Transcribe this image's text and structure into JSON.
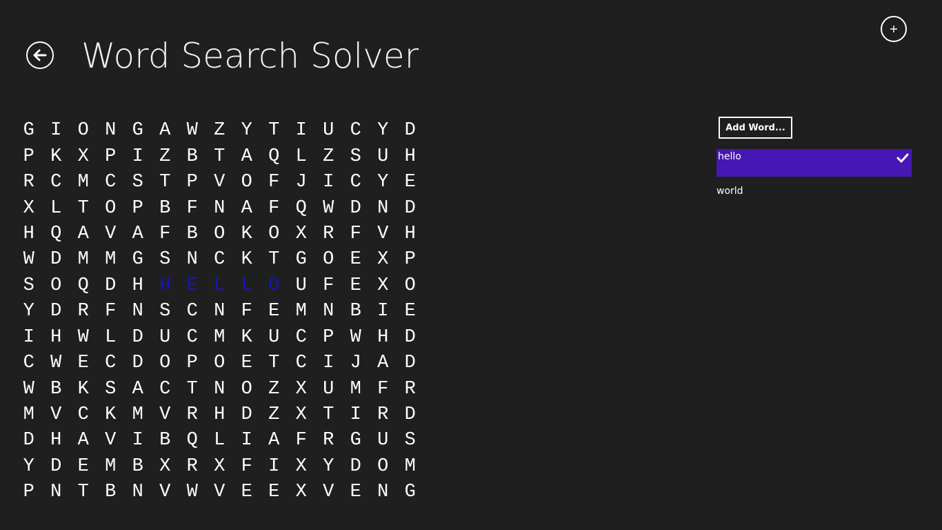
{
  "header": {
    "title": "Word Search Solver",
    "back_icon": "back-arrow-icon",
    "add_icon": "plus-icon"
  },
  "colors": {
    "background": "#1f1f1f",
    "accent": "#4617b4",
    "found_letter": "#1414c8",
    "text": "#ffffff"
  },
  "puzzle": {
    "rows": [
      [
        "G",
        "I",
        "O",
        "N",
        "G",
        "A",
        "W",
        "Z",
        "Y",
        "T",
        "I",
        "U",
        "C",
        "Y",
        "D"
      ],
      [
        "P",
        "K",
        "X",
        "P",
        "I",
        "Z",
        "B",
        "T",
        "A",
        "Q",
        "L",
        "Z",
        "S",
        "U",
        "H"
      ],
      [
        "R",
        "C",
        "M",
        "C",
        "S",
        "T",
        "P",
        "V",
        "O",
        "F",
        "J",
        "I",
        "C",
        "Y",
        "E"
      ],
      [
        "X",
        "L",
        "T",
        "O",
        "P",
        "B",
        "F",
        "N",
        "A",
        "F",
        "Q",
        "W",
        "D",
        "N",
        "D"
      ],
      [
        "H",
        "Q",
        "A",
        "V",
        "A",
        "F",
        "B",
        "O",
        "K",
        "O",
        "X",
        "R",
        "F",
        "V",
        "H"
      ],
      [
        "W",
        "D",
        "M",
        "M",
        "G",
        "S",
        "N",
        "C",
        "K",
        "T",
        "G",
        "O",
        "E",
        "X",
        "P"
      ],
      [
        "S",
        "O",
        "Q",
        "D",
        "H",
        "H",
        "E",
        "L",
        "L",
        "O",
        "U",
        "F",
        "E",
        "X",
        "O"
      ],
      [
        "Y",
        "D",
        "R",
        "F",
        "N",
        "S",
        "C",
        "N",
        "F",
        "E",
        "M",
        "N",
        "B",
        "I",
        "E"
      ],
      [
        "I",
        "H",
        "W",
        "L",
        "D",
        "U",
        "C",
        "M",
        "K",
        "U",
        "C",
        "P",
        "W",
        "H",
        "D"
      ],
      [
        "C",
        "W",
        "E",
        "C",
        "D",
        "O",
        "P",
        "O",
        "E",
        "T",
        "C",
        "I",
        "J",
        "A",
        "D"
      ],
      [
        "W",
        "B",
        "K",
        "S",
        "A",
        "C",
        "T",
        "N",
        "O",
        "Z",
        "X",
        "U",
        "M",
        "F",
        "R"
      ],
      [
        "M",
        "V",
        "C",
        "K",
        "M",
        "V",
        "R",
        "H",
        "D",
        "Z",
        "X",
        "T",
        "I",
        "R",
        "D"
      ],
      [
        "D",
        "H",
        "A",
        "V",
        "I",
        "B",
        "Q",
        "L",
        "I",
        "A",
        "F",
        "R",
        "G",
        "U",
        "S"
      ],
      [
        "Y",
        "D",
        "E",
        "M",
        "B",
        "X",
        "R",
        "X",
        "F",
        "I",
        "X",
        "Y",
        "D",
        "O",
        "M"
      ],
      [
        "P",
        "N",
        "T",
        "B",
        "N",
        "V",
        "W",
        "V",
        "E",
        "E",
        "X",
        "V",
        "E",
        "N",
        "G"
      ]
    ],
    "highlighted": [
      [
        6,
        5
      ],
      [
        6,
        6
      ],
      [
        6,
        7
      ],
      [
        6,
        8
      ],
      [
        6,
        9
      ]
    ]
  },
  "sidebar": {
    "add_word_label": "Add Word...",
    "words": [
      {
        "label": "hello",
        "selected": true,
        "icon": "checkmark-icon"
      },
      {
        "label": "world",
        "selected": false
      }
    ]
  }
}
